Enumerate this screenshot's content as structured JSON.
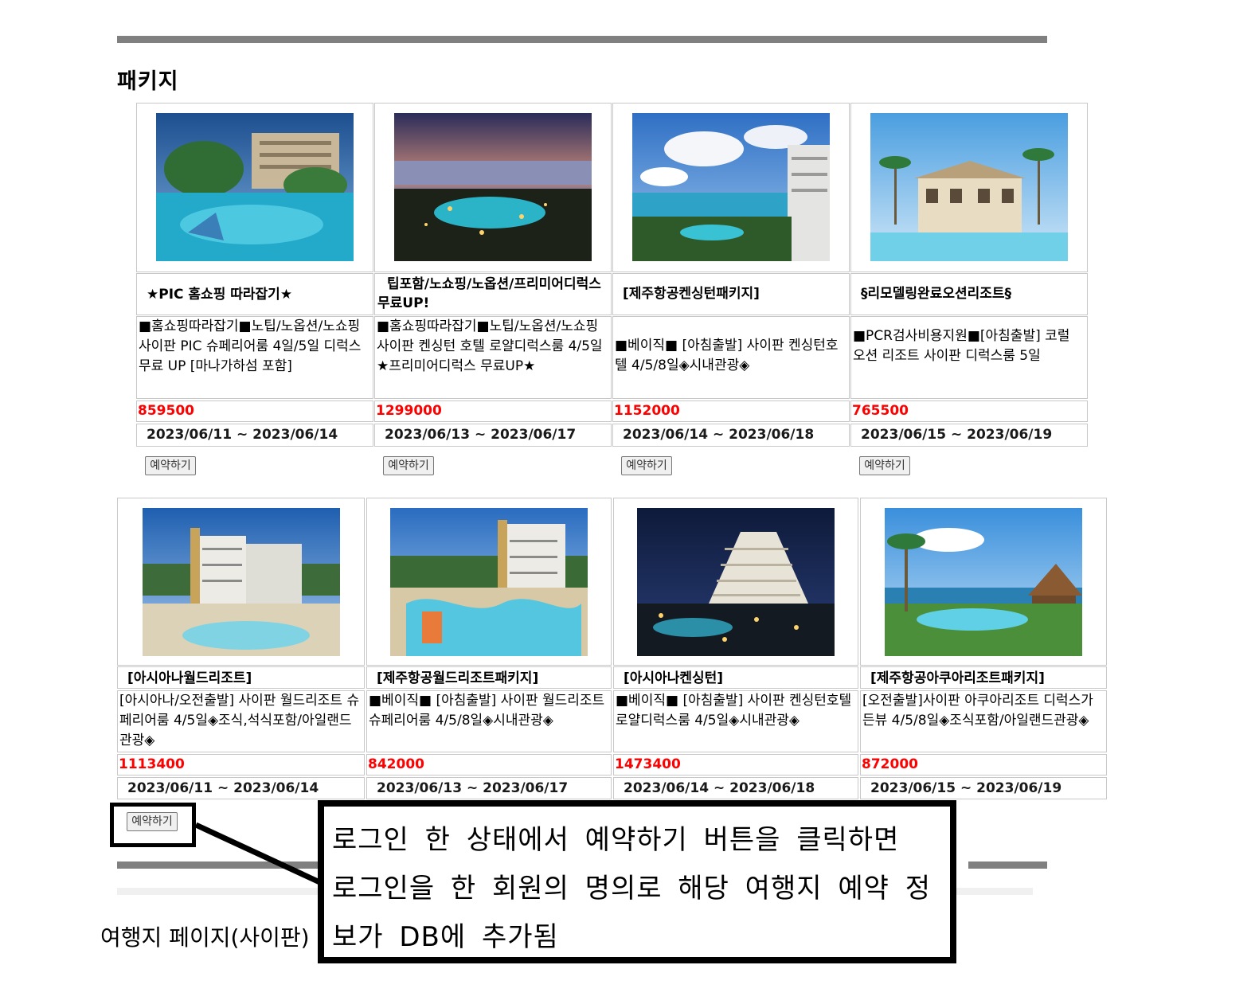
{
  "section_title": "패키지",
  "reserve_label": "예약하기",
  "packages": [
    {
      "name": "★PIC 홈쇼핑 따라잡기★",
      "description": "■홈쇼핑따라잡기■노팁/노옵션/노쇼핑 사이판 PIC 슈페리어룸 4일/5일 디럭스 무료 UP [마나가하섬 포함]",
      "price": "859500",
      "dates": "2023/06/11 ~ 2023/06/14"
    },
    {
      "name": "팁포함/노쇼핑/노옵션/프리미어디럭스 무료UP!",
      "description": "■홈쇼핑따라잡기■노팁/노옵션/노쇼핑 사이판 켄싱턴 호텔 로얄디럭스룸 4/5일★프리미어디럭스 무료UP★",
      "price": "1299000",
      "dates": "2023/06/13 ~ 2023/06/17"
    },
    {
      "name": "[제주항공켄싱턴패키지]",
      "description": "■베이직■ [아침출발] 사이판 켄싱턴호텔 4/5/8일◈시내관광◈",
      "price": "1152000",
      "dates": "2023/06/14 ~ 2023/06/18"
    },
    {
      "name": "§리모델링완료오션리조트§",
      "description": "■PCR검사비용지원■[아침출발] 코럴 오션 리조트 사이판 디럭스룸 5일",
      "price": "765500",
      "dates": "2023/06/15 ~ 2023/06/19"
    },
    {
      "name": "[아시아나월드리조트]",
      "description": "[아시아나/오전출발] 사이판 월드리조트 슈페리어룸 4/5일◈조식,석식포함/아일랜드관광◈",
      "price": "1113400",
      "dates": "2023/06/11 ~ 2023/06/14"
    },
    {
      "name": "[제주항공월드리조트패키지]",
      "description": "■베이직■ [아침출발] 사이판 월드리조트 슈페리어룸 4/5/8일◈시내관광◈",
      "price": "842000",
      "dates": "2023/06/13 ~ 2023/06/17"
    },
    {
      "name": "[아시아나켄싱턴]",
      "description": "■베이직■ [아침출발] 사이판 켄싱턴호텔 로얄디럭스룸 4/5일◈시내관광◈",
      "price": "1473400",
      "dates": "2023/06/14 ~ 2023/06/18"
    },
    {
      "name": "[제주항공아쿠아리조트패키지]",
      "description": "[오전출발]사이판 아쿠아리조트 디럭스가든뷰 4/5/8일◈조식포함/아일랜드관광◈",
      "price": "872000",
      "dates": "2023/06/15 ~ 2023/06/19"
    }
  ],
  "annotation": {
    "line1": "로그인 한 상태에서 예약하기 버튼을 클릭하면",
    "line2": "로그인을 한 회원의 명의로 해당 여행지 예약 정",
    "line3": "보가 DB에 추가됨"
  },
  "page_caption": "여행지 페이지(사이판)",
  "colors": {
    "price": "#ff0000",
    "divider": "#808080",
    "cell_border": "#c8c8c8"
  }
}
